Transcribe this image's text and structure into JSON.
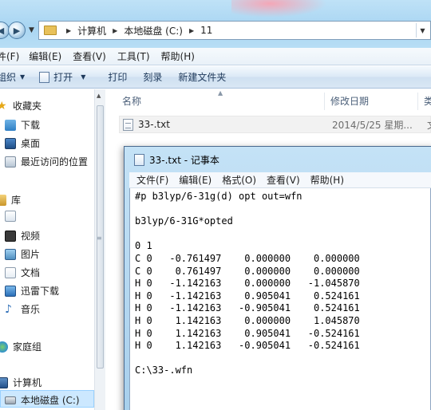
{
  "address_bar": {
    "crumbs": [
      "计算机",
      "本地磁盘 (C:)",
      "11"
    ]
  },
  "menu_bar": {
    "items": [
      "件(F)",
      "编辑(E)",
      "查看(V)",
      "工具(T)",
      "帮助(H)"
    ]
  },
  "toolbar": {
    "organize": "组织",
    "open": "打开",
    "print": "打印",
    "burn": "刻录",
    "new_folder": "新建文件夹"
  },
  "nav_pane": {
    "favorites": "收藏夹",
    "downloads": "下载",
    "desktop": "桌面",
    "recent": "最近访问的位置",
    "libraries": "库",
    "videos": "视频",
    "pictures": "图片",
    "documents": "文档",
    "xunlei": "迅雷下载",
    "music": "音乐",
    "homegroup": "家庭组",
    "computer": "计算机",
    "local_disk": "本地磁盘 (C:)"
  },
  "columns": {
    "name": "名称",
    "modified": "修改日期",
    "type": "类"
  },
  "file": {
    "name": "33-.txt",
    "date": "2014/5/25 星期...",
    "type": "文"
  },
  "notepad": {
    "title": "33-.txt - 记事本",
    "menu": [
      "文件(F)",
      "编辑(E)",
      "格式(O)",
      "查看(V)",
      "帮助(H)"
    ],
    "content": "#p b3lyp/6-31g(d) opt out=wfn\n\nb3lyp/6-31G*opted\n\n0 1\nC 0   -0.761497    0.000000    0.000000\nC 0    0.761497    0.000000    0.000000\nH 0   -1.142163    0.000000   -1.045870\nH 0   -1.142163    0.905041    0.524161\nH 0   -1.142163   -0.905041    0.524161\nH 0    1.142163    0.000000    1.045870\nH 0    1.142163    0.905041   -0.524161\nH 0    1.142163   -0.905041   -0.524161\n\nC:\\33-.wfn"
  }
}
